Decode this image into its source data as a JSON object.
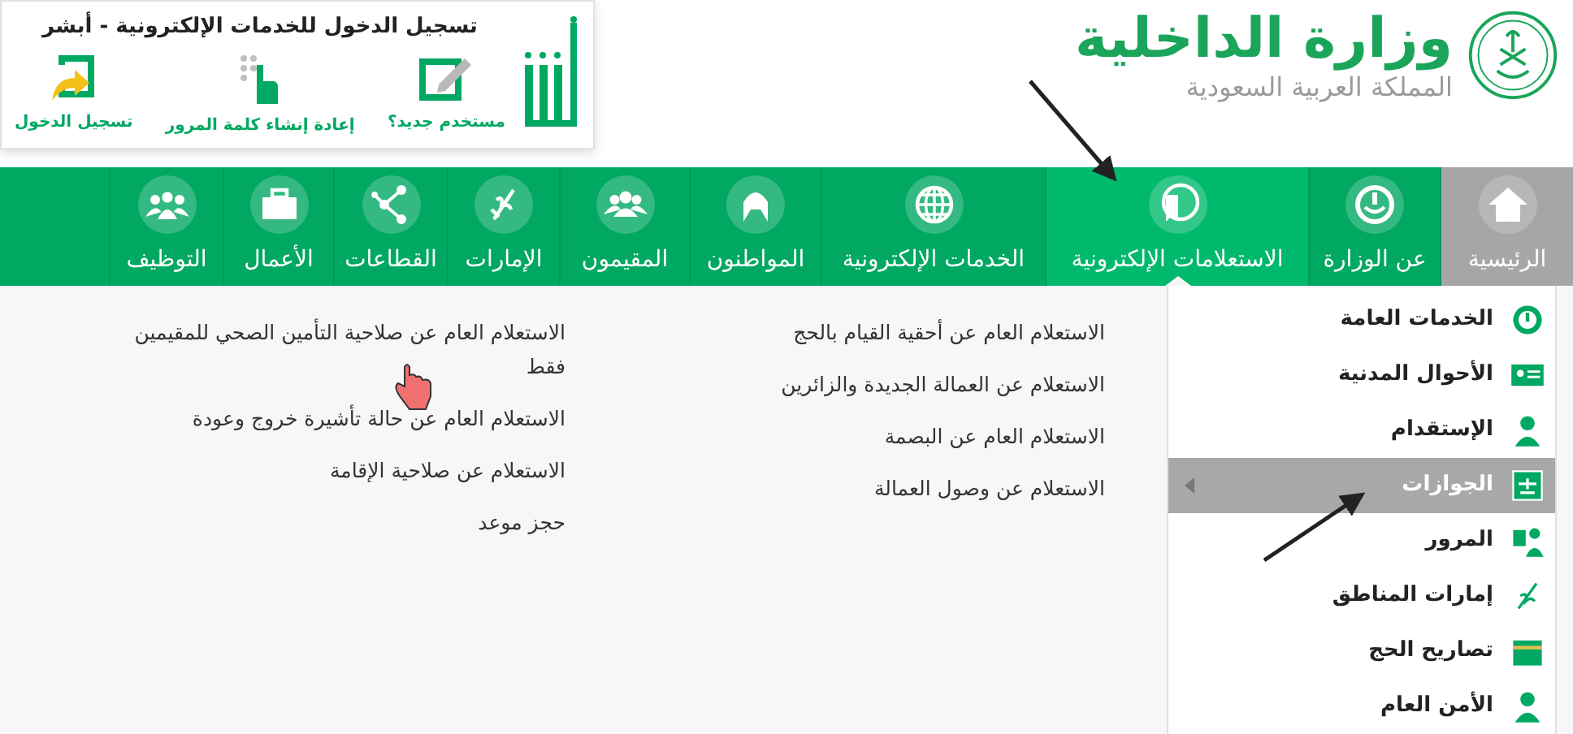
{
  "header": {
    "ministry_name": "وزارة الداخلية",
    "country": "المملكة العربية السعودية"
  },
  "absher": {
    "title": "تسجيل الدخول للخدمات الإلكترونية - أبشر",
    "actions": [
      {
        "label": "مستخدم جديد؟"
      },
      {
        "label": "إعادة إنشاء كلمة المرور"
      },
      {
        "label": "تسجيل الدخول"
      }
    ]
  },
  "nav": [
    {
      "label": "الرئيسية",
      "kind": "home",
      "selected": false
    },
    {
      "label": "عن الوزارة",
      "kind": "item",
      "selected": false
    },
    {
      "label": "الاستعلامات الإلكترونية",
      "kind": "item",
      "selected": true
    },
    {
      "label": "الخدمات الإلكترونية",
      "kind": "item",
      "selected": false
    },
    {
      "label": "المواطنون",
      "kind": "item",
      "selected": false
    },
    {
      "label": "المقيمون",
      "kind": "item",
      "selected": false
    },
    {
      "label": "الإمارات",
      "kind": "item",
      "selected": false
    },
    {
      "label": "القطاعات",
      "kind": "item",
      "selected": false
    },
    {
      "label": "الأعمال",
      "kind": "item",
      "selected": false
    },
    {
      "label": "التوظيف",
      "kind": "item",
      "selected": false
    }
  ],
  "sidebar": {
    "items": [
      {
        "label": "الخدمات العامة",
        "selected": false
      },
      {
        "label": "الأحوال المدنية",
        "selected": false
      },
      {
        "label": "الإستقدام",
        "selected": false
      },
      {
        "label": "الجوازات",
        "selected": true
      },
      {
        "label": "المرور",
        "selected": false
      },
      {
        "label": "إمارات المناطق",
        "selected": false
      },
      {
        "label": "تصاريح الحج",
        "selected": false
      },
      {
        "label": "الأمن العام",
        "selected": false
      }
    ]
  },
  "links": {
    "column_1": [
      "الاستعلام العام عن أحقية القيام بالحج",
      "الاستعلام عن العمالة الجديدة والزائرين",
      "الاستعلام العام عن البصمة",
      "الاستعلام عن وصول العمالة"
    ],
    "column_2": [
      "الاستعلام العام عن صلاحية التأمين الصحي للمقيمين فقط",
      "الاستعلام العام عن حالة تأشيرة خروج وعودة",
      "الاستعلام عن صلاحية الإقامة",
      "حجز موعد"
    ]
  }
}
